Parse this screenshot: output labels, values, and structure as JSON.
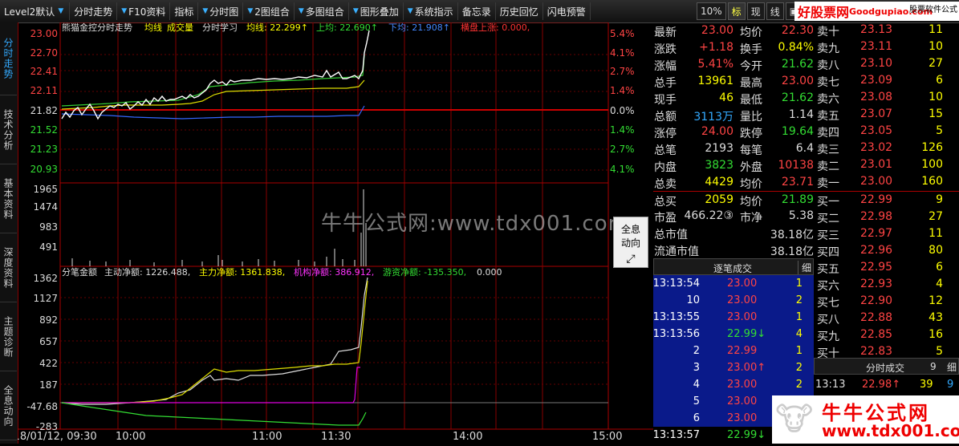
{
  "toolbar": {
    "items": [
      "Level2默认",
      "分时走势",
      "F10资料",
      "指标",
      "分时图",
      "2图组合",
      "多图组合",
      "图形叠加",
      "系统指示",
      "备忘录",
      "历史回忆",
      "闪电预警"
    ],
    "right": [
      "10%",
      "标",
      "现",
      "线"
    ],
    "brand_cn": "好股票网",
    "brand_en": "Goodgupiao.com",
    "brand_small": "股票软件公式"
  },
  "side_tabs": [
    "分时走势",
    "技术分析",
    "基本资料",
    "深度资料",
    "主题诊断",
    "全息动向"
  ],
  "chart_header": {
    "name": "熊猫金控分时走势",
    "ma_label": "均线",
    "vol_label": "成交量",
    "study_label": "分时学习",
    "ma_text": "均线: 22.299↑",
    "up_text": "上均: 22.690↑",
    "down_text": "下均: 21.908↑",
    "limit_text": "横盘上涨: 0.000,"
  },
  "price_axis": [
    "23.00",
    "22.70",
    "22.41",
    "22.11",
    "21.82",
    "21.52",
    "21.23",
    "20.93"
  ],
  "pct_axis": [
    "5.4%",
    "4.1%",
    "2.7%",
    "1.4%",
    "0.0%",
    "1.4%",
    "2.7%",
    "4.1%"
  ],
  "vol_axis": [
    "1965",
    "1474",
    "983",
    "491"
  ],
  "money_header": {
    "title": "分笔金额",
    "active_net": "主动净额: 1226.488,",
    "main_net": "主力净额: 1361.838,",
    "inst_net": "机构净额: 386.912,",
    "retail_net": "游资净额: -135.350,",
    "zero": "0.000"
  },
  "money_axis": [
    "1362",
    "1127",
    "892",
    "657",
    "422",
    "187",
    "-47.68",
    "-283"
  ],
  "time_axis": [
    "2018/01/12, 09:30",
    "10:00",
    "11:00",
    "11:30",
    "14:00",
    "15:00"
  ],
  "chart_data": {
    "type": "line",
    "x": [
      "09:30",
      "10:00",
      "10:30",
      "11:00",
      "11:30",
      "11:36"
    ],
    "series": [
      {
        "name": "价格",
        "values": [
          21.8,
          21.9,
          22.3,
          22.35,
          22.4,
          23.0
        ]
      },
      {
        "name": "均线",
        "values": [
          21.82,
          21.95,
          22.1,
          22.22,
          22.27,
          22.3
        ]
      }
    ],
    "ylim": [
      20.93,
      23.0
    ]
  },
  "quote": {
    "rows": [
      {
        "l1": "最新",
        "v1": "23.00",
        "l2": "均价",
        "v2": "22.30"
      },
      {
        "l1": "涨跌",
        "v1": "+1.18",
        "l2": "换手",
        "v2": "0.84%"
      },
      {
        "l1": "涨幅",
        "v1": "5.41%",
        "l2": "今开",
        "v2": "21.62"
      },
      {
        "l1": "总手",
        "v1": "13961",
        "l2": "最高",
        "v2": "23.00"
      },
      {
        "l1": "现手",
        "v1": "46",
        "l2": "最低",
        "v2": "21.62"
      },
      {
        "l1": "总额",
        "v1": "3113万",
        "l2": "量比",
        "v2": "1.14"
      },
      {
        "l1": "涨停",
        "v1": "24.00",
        "l2": "跌停",
        "v2": "19.64"
      },
      {
        "l1": "总笔",
        "v1": "2193",
        "l2": "每笔",
        "v2": "6.4"
      },
      {
        "l1": "内盘",
        "v1": "3823",
        "l2": "外盘",
        "v2": "10138"
      },
      {
        "l1": "总卖",
        "v1": "4429",
        "l2": "均价",
        "v2": "23.71"
      },
      {
        "l1": "总买",
        "v1": "2059",
        "l2": "均价",
        "v2": "21.89"
      },
      {
        "l1": "市盈",
        "v1": "466.22③",
        "l2": "市净",
        "v2": "5.38"
      },
      {
        "l1": "总市值",
        "v1": "",
        "l2": "",
        "v2": "38.18亿"
      },
      {
        "l1": "流通市值",
        "v1": "",
        "l2": "",
        "v2": "38.18亿"
      }
    ]
  },
  "book": {
    "sells": [
      {
        "label": "卖十",
        "price": "23.13",
        "vol": "11"
      },
      {
        "label": "卖九",
        "price": "23.11",
        "vol": "10"
      },
      {
        "label": "卖八",
        "price": "23.10",
        "vol": "27"
      },
      {
        "label": "卖七",
        "price": "23.09",
        "vol": "6"
      },
      {
        "label": "卖六",
        "price": "23.08",
        "vol": "10"
      },
      {
        "label": "卖五",
        "price": "23.07",
        "vol": "15"
      },
      {
        "label": "卖四",
        "price": "23.05",
        "vol": "5"
      },
      {
        "label": "卖三",
        "price": "23.02",
        "vol": "126"
      },
      {
        "label": "卖二",
        "price": "23.01",
        "vol": "100"
      },
      {
        "label": "卖一",
        "price": "23.00",
        "vol": "160"
      }
    ],
    "buys": [
      {
        "label": "买一",
        "price": "22.99",
        "vol": "9"
      },
      {
        "label": "买二",
        "price": "22.98",
        "vol": "27"
      },
      {
        "label": "买三",
        "price": "22.97",
        "vol": "11"
      },
      {
        "label": "买四",
        "price": "22.96",
        "vol": "80"
      },
      {
        "label": "买五",
        "price": "22.95",
        "vol": "6"
      },
      {
        "label": "买六",
        "price": "22.93",
        "vol": "4"
      },
      {
        "label": "买七",
        "price": "22.90",
        "vol": "12"
      },
      {
        "label": "买八",
        "price": "22.88",
        "vol": "43"
      },
      {
        "label": "买九",
        "price": "22.85",
        "vol": "16"
      },
      {
        "label": "买十",
        "price": "22.83",
        "vol": "5"
      }
    ]
  },
  "ticks": {
    "title": "逐笔成交",
    "detail": "细",
    "rows": [
      {
        "time": "13:13:54",
        "price": "23.00",
        "vol": "1"
      },
      {
        "time": "10",
        "price": "23.00",
        "vol": "2"
      },
      {
        "time": "13:13:55",
        "price": "23.00",
        "vol": "1"
      },
      {
        "time": "13:13:56",
        "price": "22.99↓",
        "vol": "4"
      },
      {
        "time": "2",
        "price": "22.99",
        "vol": "1"
      },
      {
        "time": "3",
        "price": "23.00↑",
        "vol": "2"
      },
      {
        "time": "4",
        "price": "23.00",
        "vol": "2"
      },
      {
        "time": "5",
        "price": "23.00",
        "vol": "2"
      },
      {
        "time": "6",
        "price": "23.00",
        "vol": "2"
      },
      {
        "time": "13:13:57",
        "price": "22.99↓",
        "vol": "1"
      }
    ]
  },
  "fenshi": {
    "title": "分时成交",
    "num": "9",
    "detail": "细",
    "time": "13:13",
    "price": "22.98↑",
    "vol": "39",
    "flag": "9"
  },
  "watermark": "牛牛公式网:www.tdx001.com",
  "popup": {
    "line1": "全息",
    "line2": "动向"
  },
  "ad": {
    "cn": "牛牛公式网",
    "url": "www.tdx001.com"
  }
}
